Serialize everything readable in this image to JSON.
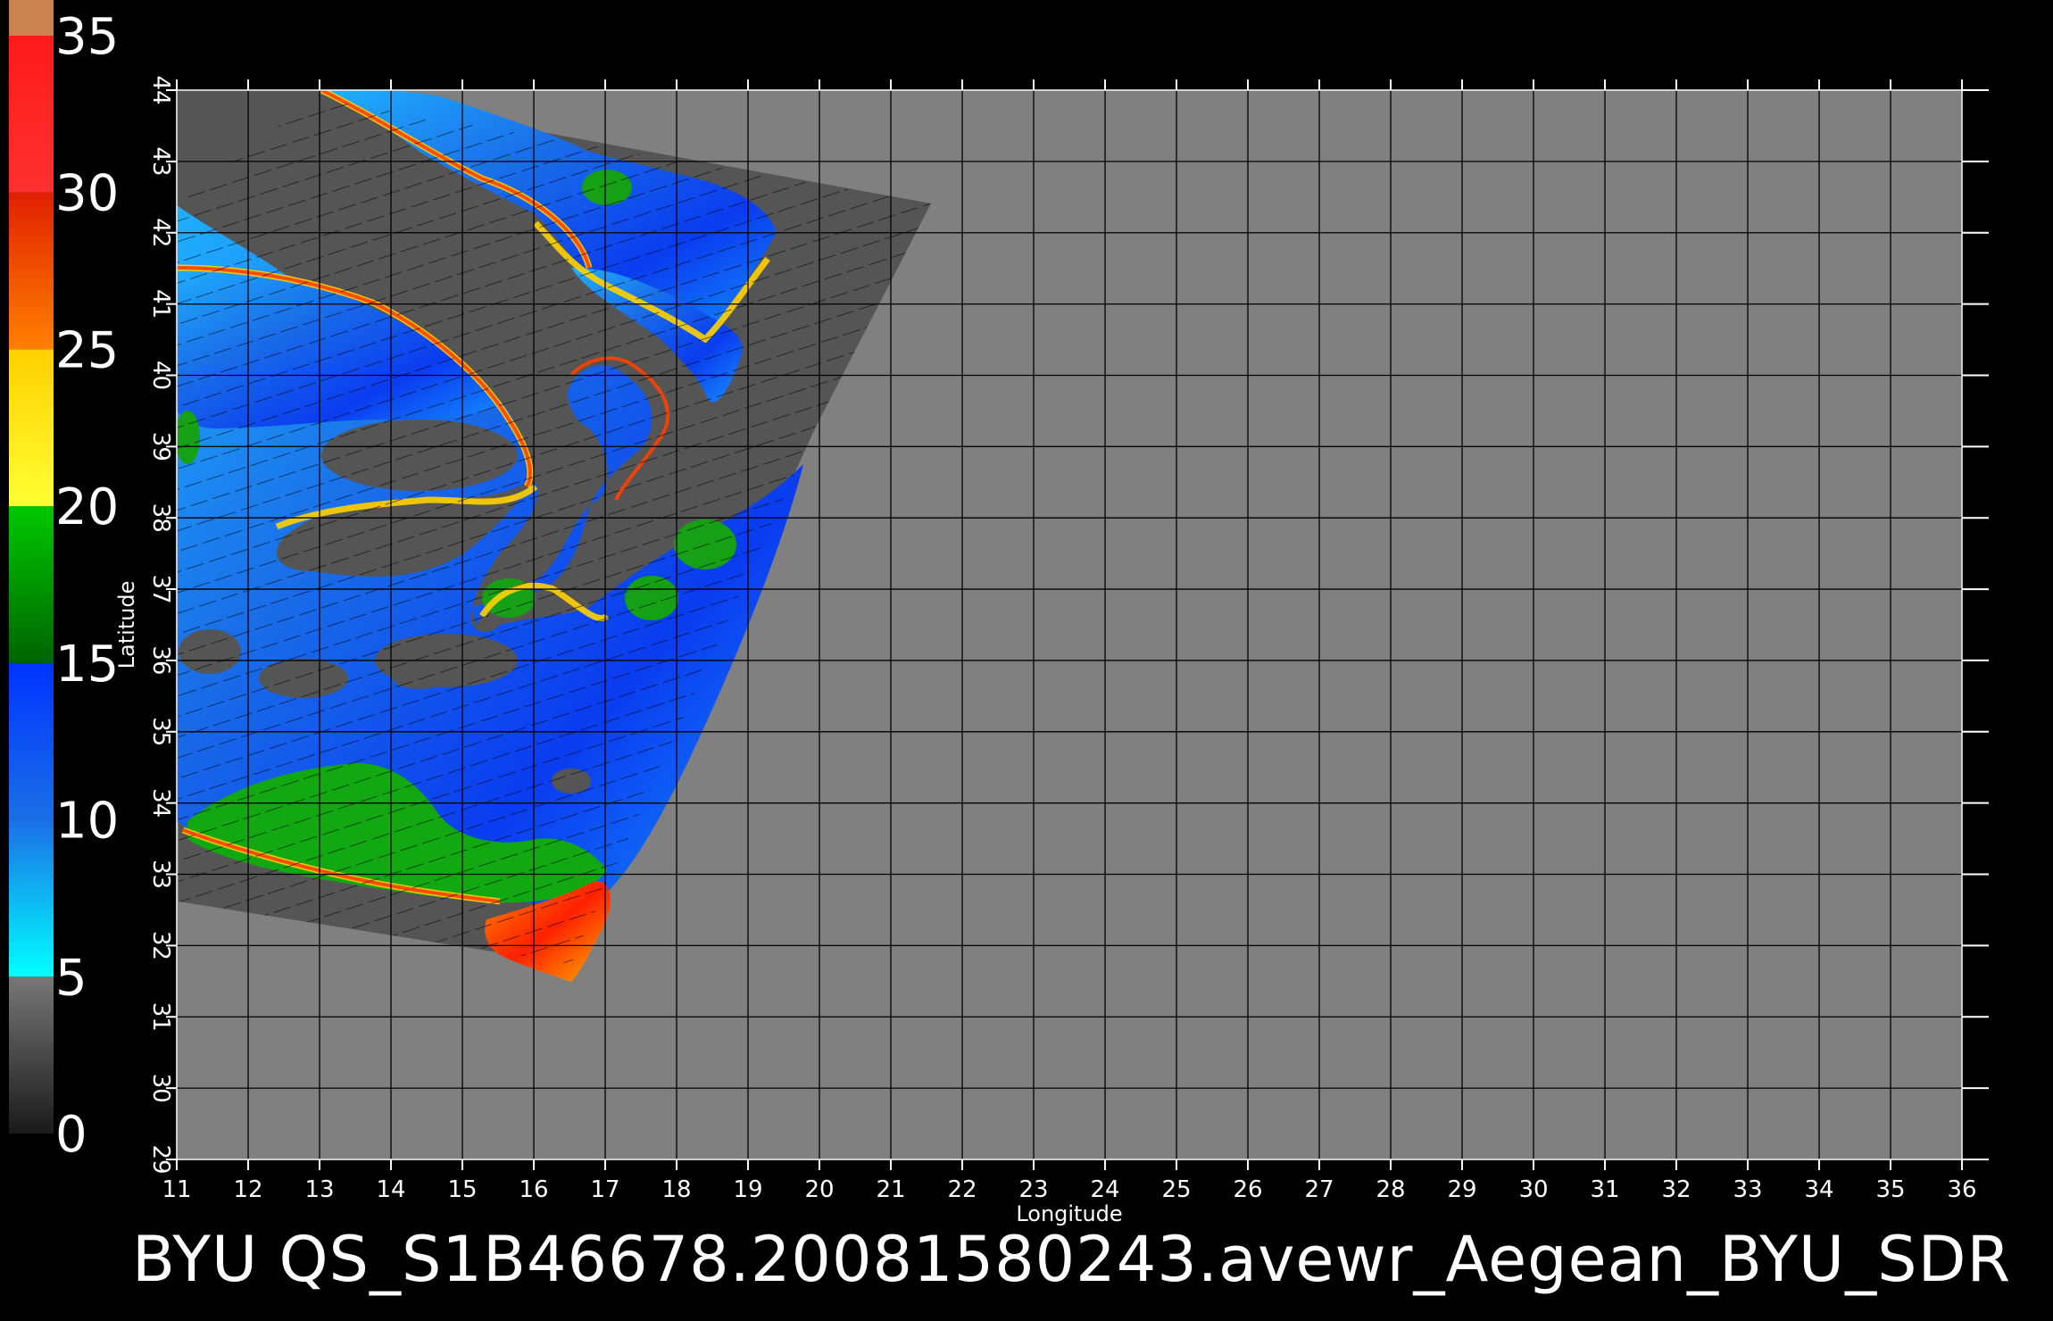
{
  "caption": "BYU  QS_S1B46678.20081580243.avewr_Aegean_BYU_SDR",
  "colorbar": {
    "labels": [
      "35",
      "30",
      "25",
      "20",
      "15",
      "10",
      "5",
      "0"
    ],
    "segments": [
      {
        "from": 0,
        "to": 5,
        "top": "#777777",
        "bottom": "#1a1a1a"
      },
      {
        "from": 5,
        "to": 10,
        "top": "#1b6fe6",
        "bottom": "#00ffff"
      },
      {
        "from": 10,
        "to": 15,
        "top": "#0033ff",
        "bottom": "#1b6fe6"
      },
      {
        "from": 15,
        "to": 20,
        "top": "#00c800",
        "bottom": "#006400"
      },
      {
        "from": 20,
        "to": 25,
        "top": "#ffd000",
        "bottom": "#ffff33"
      },
      {
        "from": 25,
        "to": 30,
        "top": "#e02000",
        "bottom": "#ff8000"
      },
      {
        "from": 30,
        "to": 35,
        "top": "#ff1a1a",
        "bottom": "#ff3030"
      }
    ],
    "cap": "#c8834f"
  },
  "map": {
    "xlabel": "Longitude",
    "ylabel": "Latitude",
    "lon_ticks": [
      "11",
      "12",
      "13",
      "14",
      "15",
      "16",
      "17",
      "18",
      "19",
      "20",
      "21",
      "22",
      "23",
      "24",
      "25",
      "26",
      "27",
      "28",
      "29",
      "30",
      "31",
      "32",
      "33",
      "34",
      "35",
      "36"
    ],
    "lat_ticks": [
      "29",
      "30",
      "31",
      "32",
      "33",
      "34",
      "35",
      "36",
      "37",
      "38",
      "39",
      "40",
      "41",
      "42",
      "43",
      "44"
    ],
    "lon_range": [
      11,
      36
    ],
    "lat_range": [
      29,
      44
    ],
    "background_color": "#808080",
    "land_color": "#555555",
    "grid_color": "#000000"
  }
}
